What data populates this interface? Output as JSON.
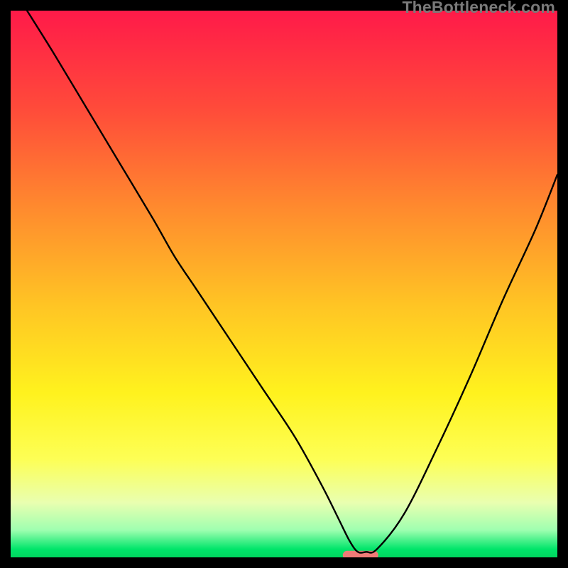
{
  "attribution": "TheBottleneck.com",
  "chart_data": {
    "type": "line",
    "title": "",
    "xlabel": "",
    "ylabel": "",
    "xlim": [
      0,
      100
    ],
    "ylim": [
      0,
      100
    ],
    "grid": false,
    "legend": false,
    "background": {
      "type": "vertical-gradient",
      "stops": [
        {
          "pos": 0.0,
          "color": "#ff1a49"
        },
        {
          "pos": 0.18,
          "color": "#ff4b3a"
        },
        {
          "pos": 0.36,
          "color": "#ff8a2e"
        },
        {
          "pos": 0.54,
          "color": "#ffc524"
        },
        {
          "pos": 0.7,
          "color": "#fff21e"
        },
        {
          "pos": 0.82,
          "color": "#fdff55"
        },
        {
          "pos": 0.9,
          "color": "#e9ffb0"
        },
        {
          "pos": 0.95,
          "color": "#9fffb0"
        },
        {
          "pos": 0.985,
          "color": "#00e56a"
        },
        {
          "pos": 1.0,
          "color": "#00d65f"
        }
      ]
    },
    "series": [
      {
        "name": "bottleneck-curve",
        "color": "#000000",
        "stroke_width": 2.4,
        "x": [
          3,
          8,
          14,
          20,
          26,
          30,
          34,
          40,
          46,
          52,
          57,
          60,
          62,
          63.5,
          65,
          67,
          72,
          78,
          84,
          90,
          96,
          100
        ],
        "y": [
          100,
          92,
          82,
          72,
          62,
          55,
          49,
          40,
          31,
          22,
          13,
          7,
          3,
          1,
          1,
          1.5,
          8,
          20,
          33,
          47,
          60,
          70
        ]
      }
    ],
    "markers": [
      {
        "name": "optimal-marker",
        "shape": "pill",
        "color": "#ef7b77",
        "cx": 64,
        "cy": 0.4,
        "width": 6.5,
        "height": 1.6
      }
    ]
  }
}
